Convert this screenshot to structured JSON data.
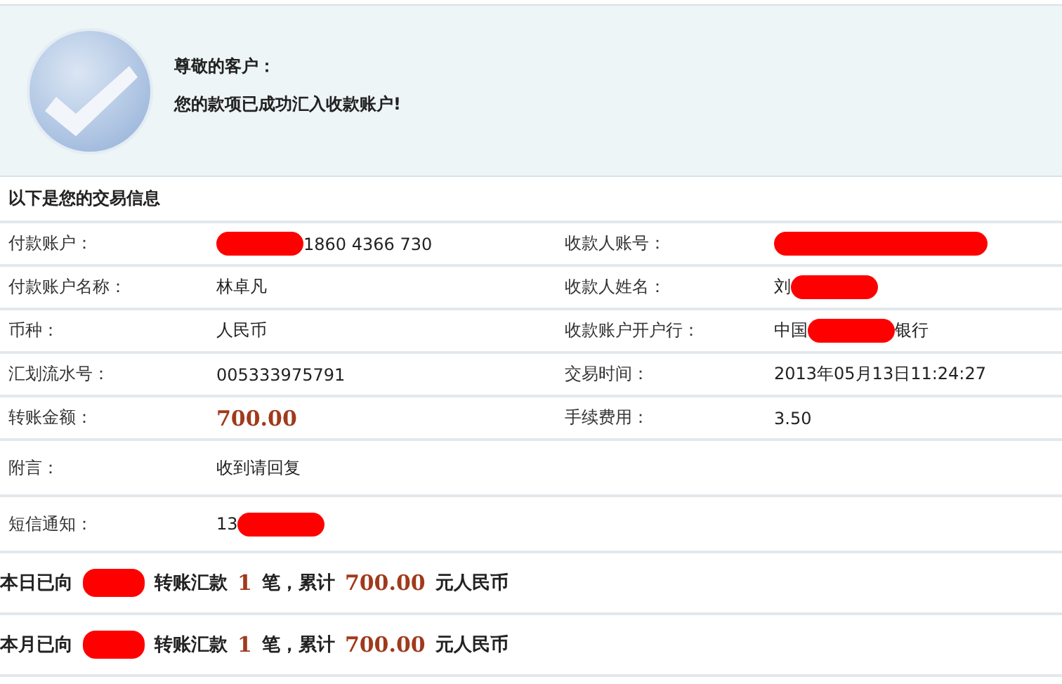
{
  "notice": {
    "greeting": "尊敬的客户：",
    "message": "您的款项已成功汇入收款账户!"
  },
  "section_title": "以下是您的交易信息",
  "rows": [
    {
      "cells": [
        {
          "label": "付款账户：",
          "value": [
            {
              "kind": "redaction"
            },
            {
              "kind": "text",
              "text": "1860 4366 730"
            }
          ]
        },
        {
          "label": "收款人账号：",
          "value": [
            {
              "kind": "long-redaction"
            }
          ]
        }
      ]
    },
    {
      "cells": [
        {
          "label": "付款账户名称：",
          "value": [
            {
              "kind": "text",
              "text": "林卓凡"
            }
          ]
        },
        {
          "label": "收款人姓名：",
          "value": [
            {
              "kind": "text",
              "text": "刘"
            },
            {
              "kind": "redaction"
            }
          ]
        }
      ]
    },
    {
      "cells": [
        {
          "label": "币种：",
          "value": [
            {
              "kind": "text",
              "text": "人民币"
            }
          ]
        },
        {
          "label": "收款账户开户行：",
          "value": [
            {
              "kind": "text",
              "text": "中国"
            },
            {
              "kind": "redaction"
            },
            {
              "kind": "text",
              "text": "银行"
            }
          ]
        }
      ]
    },
    {
      "cells": [
        {
          "label": "汇划流水号：",
          "value": [
            {
              "kind": "text",
              "text": "005333975791"
            }
          ]
        },
        {
          "label": "交易时间：",
          "value": [
            {
              "kind": "text",
              "text": "2013年05月13日11:24:27"
            }
          ]
        }
      ]
    },
    {
      "cells": [
        {
          "label": "转账金额：",
          "value": [
            {
              "kind": "amount",
              "text": "700.00"
            }
          ]
        },
        {
          "label": "手续费用：",
          "value": [
            {
              "kind": "text",
              "text": "3.50"
            }
          ]
        }
      ]
    },
    {
      "cells": [
        {
          "label": "附言：",
          "value": [
            {
              "kind": "text",
              "text": "收到请回复"
            }
          ]
        }
      ]
    },
    {
      "cells": [
        {
          "label": "短信通知：",
          "value": [
            {
              "kind": "text",
              "text": "13"
            },
            {
              "kind": "redaction"
            }
          ]
        }
      ]
    }
  ],
  "summaries": [
    [
      {
        "kind": "text",
        "text": "本日已向"
      },
      {
        "kind": "redaction"
      },
      {
        "kind": "text",
        "text": "转账汇款"
      },
      {
        "kind": "number",
        "text": "1"
      },
      {
        "kind": "text",
        "text": "笔，累计"
      },
      {
        "kind": "number",
        "text": "700.00"
      },
      {
        "kind": "text",
        "text": "元人民币"
      }
    ],
    [
      {
        "kind": "text",
        "text": "本月已向"
      },
      {
        "kind": "redaction"
      },
      {
        "kind": "text",
        "text": "转账汇款"
      },
      {
        "kind": "number",
        "text": "1"
      },
      {
        "kind": "text",
        "text": "笔，累计"
      },
      {
        "kind": "number",
        "text": "700.00"
      },
      {
        "kind": "text",
        "text": "元人民币"
      }
    ]
  ]
}
